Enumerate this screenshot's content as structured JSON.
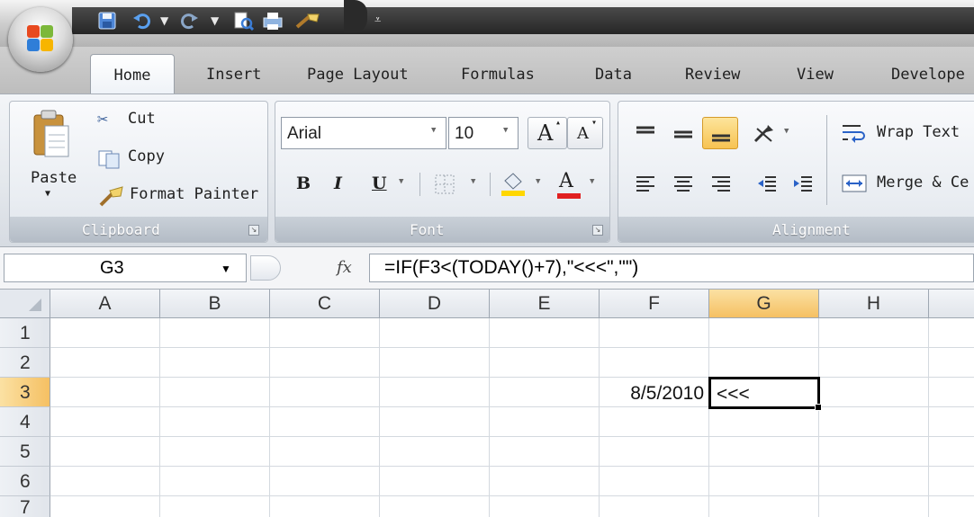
{
  "tabs": [
    "Home",
    "Insert",
    "Page Layout",
    "Formulas",
    "Data",
    "Review",
    "View",
    "Develope"
  ],
  "clipboard": {
    "paste_label": "Paste",
    "cut_label": "Cut",
    "copy_label": "Copy",
    "format_painter_label": "Format Painter",
    "group_label": "Clipboard"
  },
  "font": {
    "font_name": "Arial",
    "font_size": "10",
    "group_label": "Font",
    "bold": "B",
    "italic": "I",
    "underline": "U",
    "grow": "A",
    "shrink": "A",
    "font_color": "A"
  },
  "alignment": {
    "wrap_text_label": "Wrap Text",
    "merge_label": "Merge & Ce",
    "group_label": "Alignment"
  },
  "formula_bar": {
    "name_box": "G3",
    "fx": "fx",
    "formula": "=IF(F3<(TODAY()+7),\"<<<\",\"\")"
  },
  "sheet": {
    "columns": [
      "A",
      "B",
      "C",
      "D",
      "E",
      "F",
      "G",
      "H"
    ],
    "rows": [
      "1",
      "2",
      "3",
      "4",
      "5",
      "6",
      "7"
    ],
    "selected_cell": "G3",
    "cells": {
      "F3": "8/5/2010",
      "G3": "<<<"
    }
  },
  "colors": {
    "selection_header": "#f5c063",
    "font_color_underline": "#e02020",
    "highlight_yellow": "#ffd700"
  }
}
